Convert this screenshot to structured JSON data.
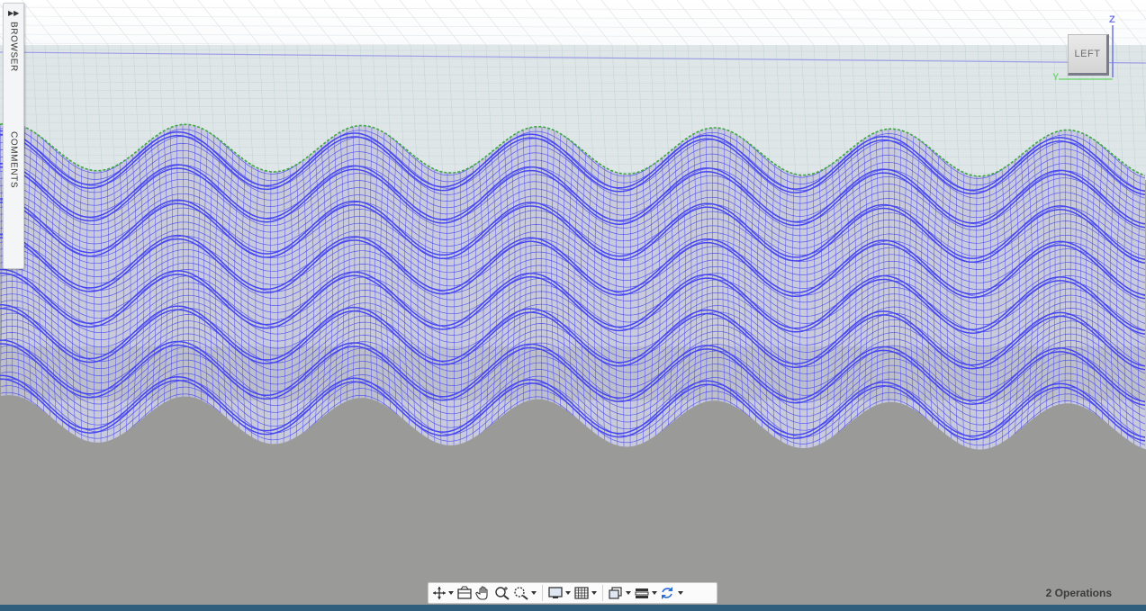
{
  "side_panel": {
    "browser_label": "BROWSER",
    "comments_label": "COMMENTS"
  },
  "view_cube": {
    "face_label": "LEFT",
    "z_axis": "Z",
    "y_axis": "Y"
  },
  "toolbar": {
    "icons": [
      "orbit-icon",
      "look-at-icon",
      "pan-icon",
      "zoom-icon",
      "fit-icon",
      "display-settings-icon",
      "grid-snaps-icon",
      "viewports-icon",
      "layers-icon",
      "refresh-icon"
    ]
  },
  "status": {
    "operations": "2 Operations"
  },
  "colors": {
    "wireframe": "#4747f0",
    "silhouette": "#3aa83a",
    "ground": "#9a9a98",
    "sky": "#ffffff",
    "grid": "#c7d4d7",
    "status_bar": "#2f5f7c"
  }
}
